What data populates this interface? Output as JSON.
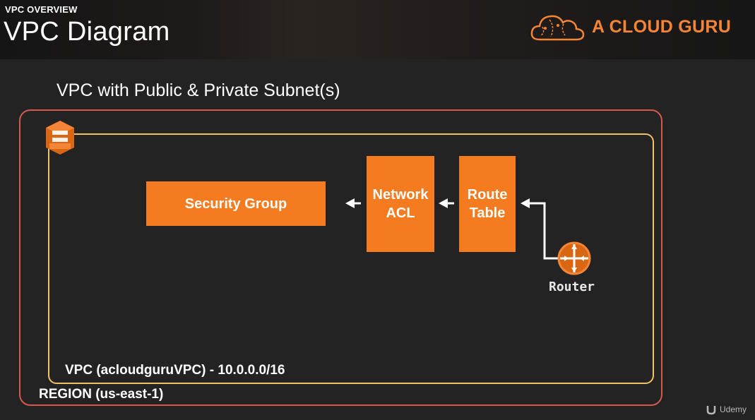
{
  "header": {
    "overline": "VPC OVERVIEW",
    "title": "VPC Diagram",
    "brand": "A CLOUD GURU"
  },
  "diagram": {
    "subtitle": "VPC with Public & Private Subnet(s)",
    "security_group": "Security Group",
    "network_acl_line1": "Network",
    "network_acl_line2": "ACL",
    "route_table_line1": "Route",
    "route_table_line2": "Table",
    "router": "Router",
    "vpc_label": "VPC (acloudguruVPC) - 10.0.0.0/16",
    "region_label": "REGION (us-east-1)"
  },
  "watermark": "Udemy",
  "colors": {
    "accent": "#f47b20",
    "region_border": "#d65a4a",
    "vpc_border": "#f2c26a",
    "background": "#232323"
  }
}
